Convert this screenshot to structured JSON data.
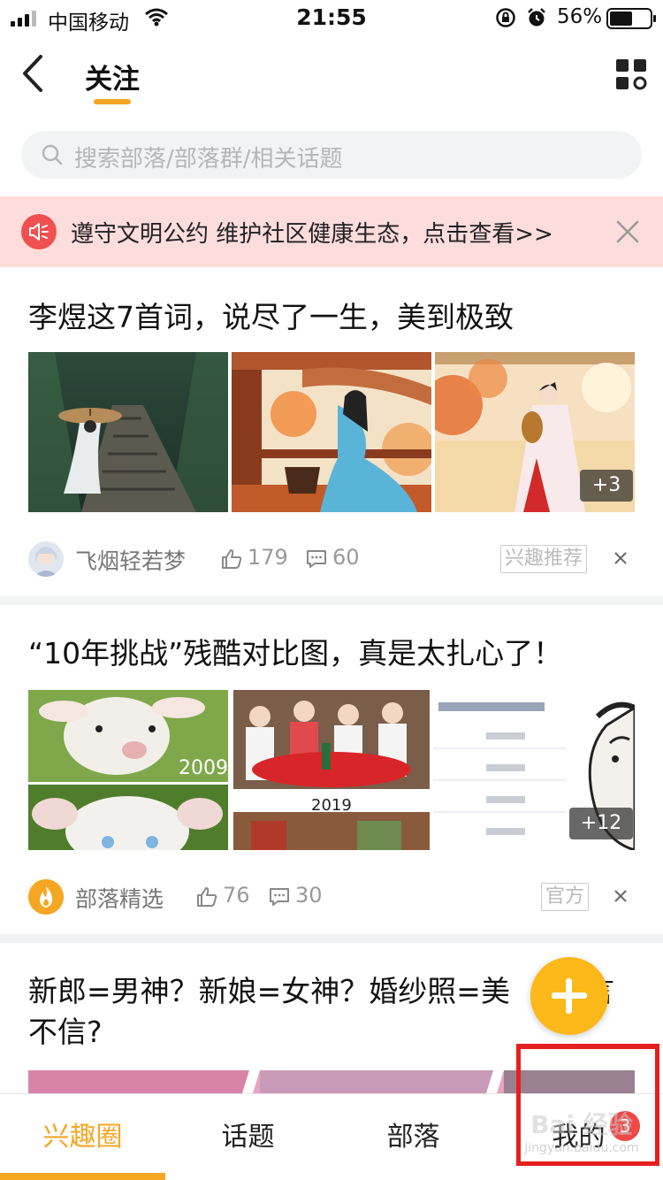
{
  "status_bar": {
    "carrier": "中国移动",
    "time": "21:55",
    "battery_percent": "56%",
    "battery_level": 0.56
  },
  "nav": {
    "title": "关注",
    "back_icon": "chevron-left-icon",
    "menu_icon": "grid-menu-icon"
  },
  "search": {
    "placeholder": "搜索部落/部落群/相关话题"
  },
  "notice": {
    "text": "遵守文明公约 维护社区健康生态，点击查看>>",
    "color": "#f05050"
  },
  "posts": [
    {
      "title": "李煜这7首词，说尽了一生，美到极致",
      "more_count": "+3",
      "author": "飞烟轻若梦",
      "likes": "179",
      "comments": "60",
      "tag": "兴趣推荐"
    },
    {
      "title": "“10年挑战”残酷对比图，真是太扎心了！",
      "more_count": "+12",
      "author": "部落精选",
      "likes": "76",
      "comments": "30",
      "tag": "官方",
      "image_year_1": "2009",
      "image_year_2": "2019"
    },
    {
      "title_line1": "新郎=男神？新娘=女神？婚纱照=美",
      "title_line1_tail": "言",
      "title_line2": "不信?"
    }
  ],
  "tabs": [
    {
      "label": "兴趣圈",
      "active": true
    },
    {
      "label": "话题",
      "active": false
    },
    {
      "label": "部落",
      "active": false
    },
    {
      "label": "我的",
      "active": false
    }
  ],
  "my_badge": "3",
  "watermark": {
    "main": "Bai 经验",
    "sub": "jingyan.baidu.com"
  },
  "colors": {
    "accent": "#f5a623",
    "fab": "#fbb818",
    "badge": "#f04848",
    "annotation": "#e52020"
  }
}
